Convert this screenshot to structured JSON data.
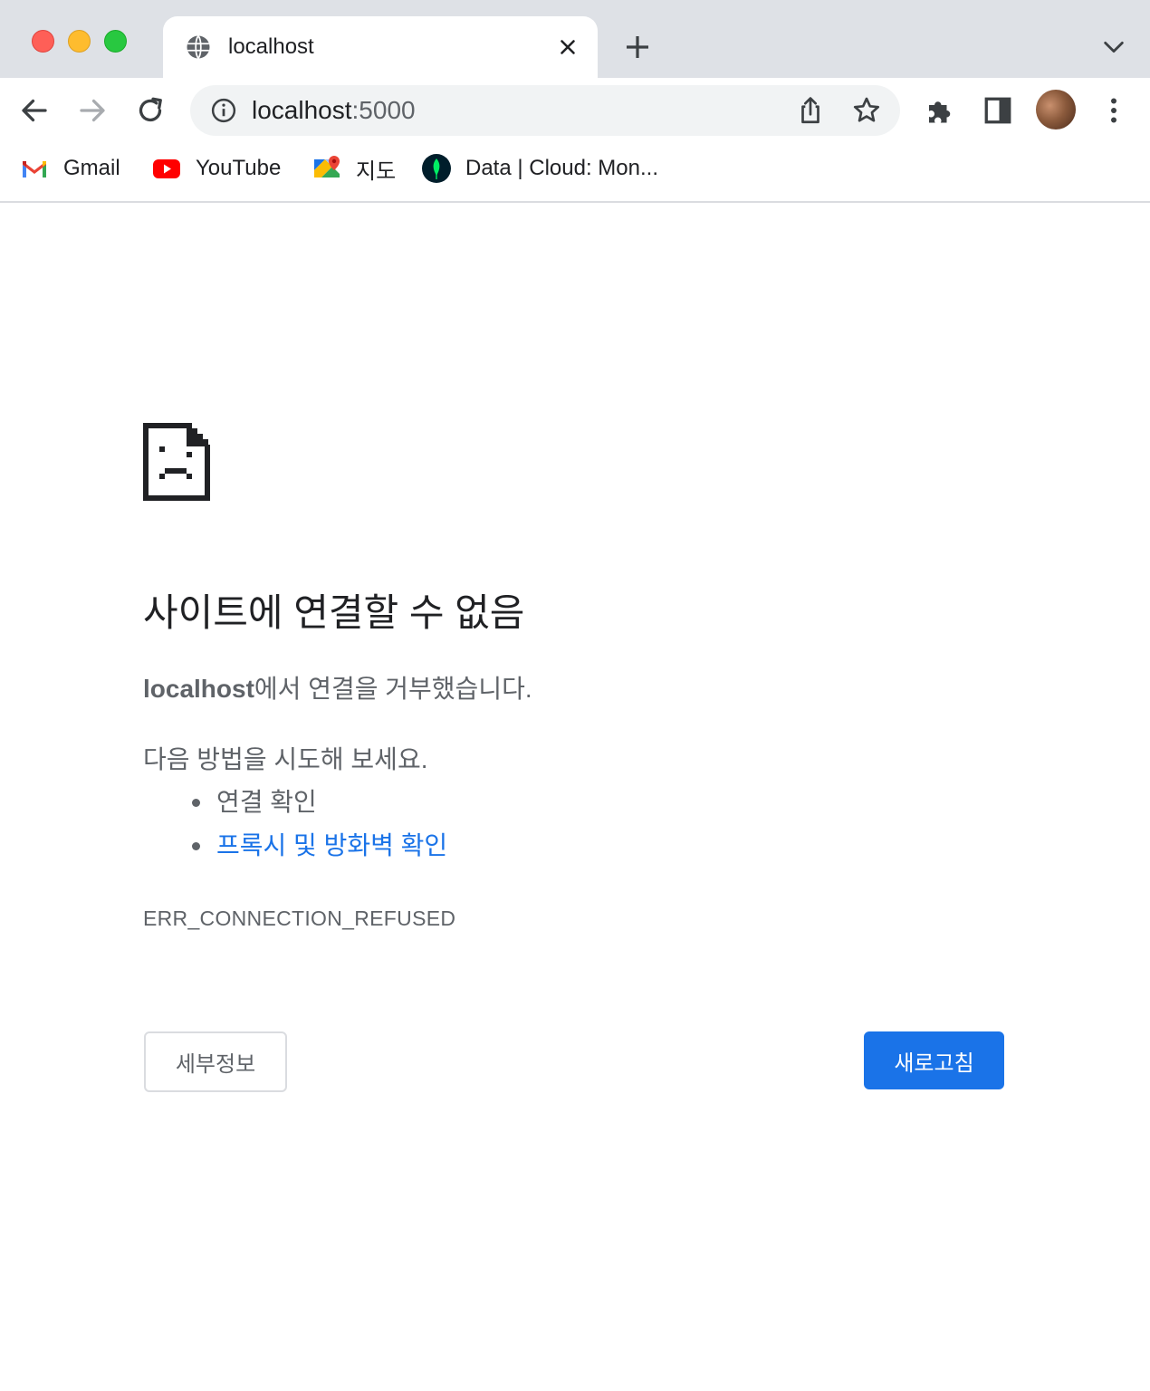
{
  "tab": {
    "title": "localhost",
    "close_icon": "close-icon",
    "favicon": "globe-icon"
  },
  "toolbar": {
    "url_host": "localhost",
    "url_port": ":5000",
    "icons": [
      "back-arrow-icon",
      "forward-arrow-icon",
      "reload-icon",
      "info-icon",
      "share-icon",
      "star-icon",
      "extensions-puzzle-icon",
      "side-panel-icon",
      "profile-avatar",
      "more-vert-icon"
    ]
  },
  "bookmarks": [
    {
      "label": "Gmail",
      "icon": "gmail-icon"
    },
    {
      "label": "YouTube",
      "icon": "youtube-icon"
    },
    {
      "label": "지도",
      "icon": "maps-icon"
    },
    {
      "label": "Data | Cloud: Mon...",
      "icon": "mongodb-leaf-icon"
    }
  ],
  "error": {
    "heading": "사이트에 연결할 수 없음",
    "host": "localhost",
    "refused_text": "에서 연결을 거부했습니다.",
    "try_text": "다음 방법을 시도해 보세요.",
    "suggestions": [
      {
        "label": "연결 확인",
        "link": false
      },
      {
        "label": "프록시 및 방화벽 확인",
        "link": true
      }
    ],
    "code": "ERR_CONNECTION_REFUSED",
    "details_button": "세부정보",
    "reload_button": "새로고침"
  },
  "colors": {
    "accent": "#1a73e8",
    "tabstrip": "#dee1e6",
    "omnibox": "#f1f3f4",
    "text_primary": "#202124",
    "text_secondary": "#5f6368"
  }
}
